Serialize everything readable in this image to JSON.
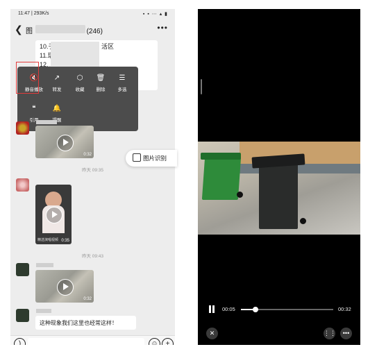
{
  "chat": {
    "status_time": "11:47 | 293K/s",
    "status_icons": "▪ ▪ ⋯ ▴ ▮",
    "title": "图",
    "title_count": "(246)",
    "quoted_lines": [
      "10.于",
      "11.瑞",
      "12.上"
    ],
    "quoted_tail": "活区",
    "context_menu": [
      {
        "icon": "speaker-mute-icon",
        "glyph": "🔇",
        "label": "静音播放"
      },
      {
        "icon": "forward-icon",
        "glyph": "↗",
        "label": "转发"
      },
      {
        "icon": "favorite-icon",
        "glyph": "⬡",
        "label": "收藏"
      },
      {
        "icon": "delete-icon",
        "glyph": "🗑",
        "label": "删除"
      },
      {
        "icon": "multi-select-icon",
        "glyph": "☰",
        "label": "多选"
      },
      {
        "icon": "quote-icon",
        "glyph": "❝",
        "label": "引用"
      },
      {
        "icon": "remind-icon",
        "glyph": "🔔",
        "label": "提醒"
      }
    ],
    "video1_duration": "0:32",
    "ocr_button_label": "图片识别",
    "timestamp1": "昨天 09:35",
    "video2_duration": "0:35",
    "video2_caption": "精选演唱视频",
    "timestamp2": "昨天 09:43",
    "video3_duration": "0:32",
    "text_message": "这种现象我们这里也经常这样！"
  },
  "player": {
    "current_time": "00:05",
    "total_time": "00:32",
    "progress": 0.16,
    "colors": {
      "bin_green": "#2e8b3a",
      "bin_dark": "#2a2c2b"
    }
  }
}
